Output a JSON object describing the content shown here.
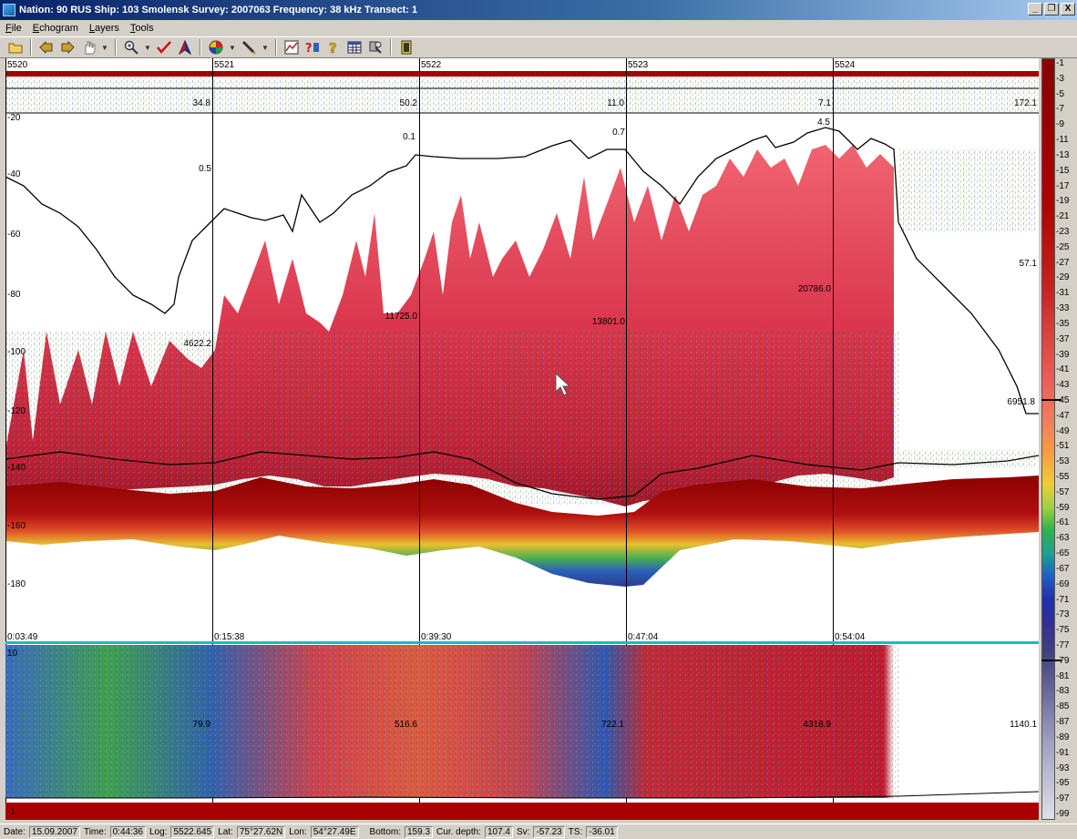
{
  "window": {
    "title": "Nation: 90 RUS  Ship: 103 Smolensk  Survey: 2007063  Frequency: 38 kHz  Transect: 1",
    "minimize": "_",
    "restore": "❐",
    "close": "X"
  },
  "menu": {
    "file": {
      "ul": "F",
      "rest": "ile"
    },
    "echogram": {
      "ul": "E",
      "rest": "chogram"
    },
    "layers": {
      "ul": "L",
      "rest": "ayers"
    },
    "tools": {
      "ul": "T",
      "rest": "ools"
    }
  },
  "toolbar": {
    "icons": [
      "open-folder-icon",
      "prev-icon",
      "next-icon",
      "hand-icon",
      "zoom-icon",
      "check-icon",
      "navigate-icon",
      "palette-icon",
      "pen-icon",
      "chart-icon",
      "help-context-icon",
      "help-icon",
      "table-icon",
      "settings-icon",
      "exit-icon"
    ]
  },
  "echogram": {
    "distance_marks": [
      "5520",
      "5521",
      "5522",
      "5523",
      "5524"
    ],
    "depth_labels": [
      "-20",
      "-40",
      "-60",
      "-80",
      "-100",
      "-120",
      "-140",
      "-160",
      "-180"
    ],
    "time_marks": [
      "0:03:49",
      "0:15:38",
      "0:39:30",
      "0:47:04",
      "0:54:04"
    ],
    "upper_values": [
      "34.8",
      "50.2",
      "11.0",
      "7.1",
      "172.1"
    ],
    "school_values": [
      "0.1",
      "0.5",
      "0.7",
      "4.5",
      "4622.2",
      "11725.0",
      "13801.0",
      "20786.0",
      "57.1",
      "6951.8"
    ],
    "lower_values": [
      "79.9",
      "516.6",
      "722.1",
      "4318.9",
      "1140.1"
    ],
    "lower_top_label": "10",
    "lower_bottom_label": "-1"
  },
  "palette": {
    "labels": [
      "-1",
      "-3",
      "-5",
      "-7",
      "-9",
      "-11",
      "-13",
      "-15",
      "-17",
      "-19",
      "-21",
      "-23",
      "-25",
      "-27",
      "-29",
      "-31",
      "-33",
      "-35",
      "-37",
      "-39",
      "-41",
      "-43",
      "-45",
      "-47",
      "-49",
      "-51",
      "-53",
      "-55",
      "-57",
      "-59",
      "-61",
      "-63",
      "-65",
      "-67",
      "-69",
      "-71",
      "-73",
      "-75",
      "-77",
      "-79",
      "-81",
      "-83",
      "-85",
      "-87",
      "-89",
      "-91",
      "-93",
      "-95",
      "-97",
      "-99"
    ],
    "threshold_upper": -45,
    "threshold_lower": -79
  },
  "status": {
    "date_label": "Date:",
    "date": "15.09.2007",
    "time_label": "Time:",
    "time": "0:44:36",
    "log_label": "Log:",
    "log": "5522.645",
    "lat_label": "Lat:",
    "lat": "75°27.62N",
    "lon_label": "Lon:",
    "lon": "54°27.49E",
    "bottom_label": "Bottom:",
    "bottom": "159.3",
    "depth_label": "Cur. depth:",
    "depth": "107.4",
    "sv_label": "Sv:",
    "sv": "-57.23",
    "ts_label": "TS:",
    "ts": "-36.01"
  },
  "colors": {
    "seabed": "#8b0000",
    "fish_red": "#d8324a",
    "fish_green": "#3aa84a",
    "fish_blue": "#2a4fb0",
    "title_start": "#0a246a",
    "title_end": "#a6caf0",
    "threshold_line": "#17bcc4"
  }
}
